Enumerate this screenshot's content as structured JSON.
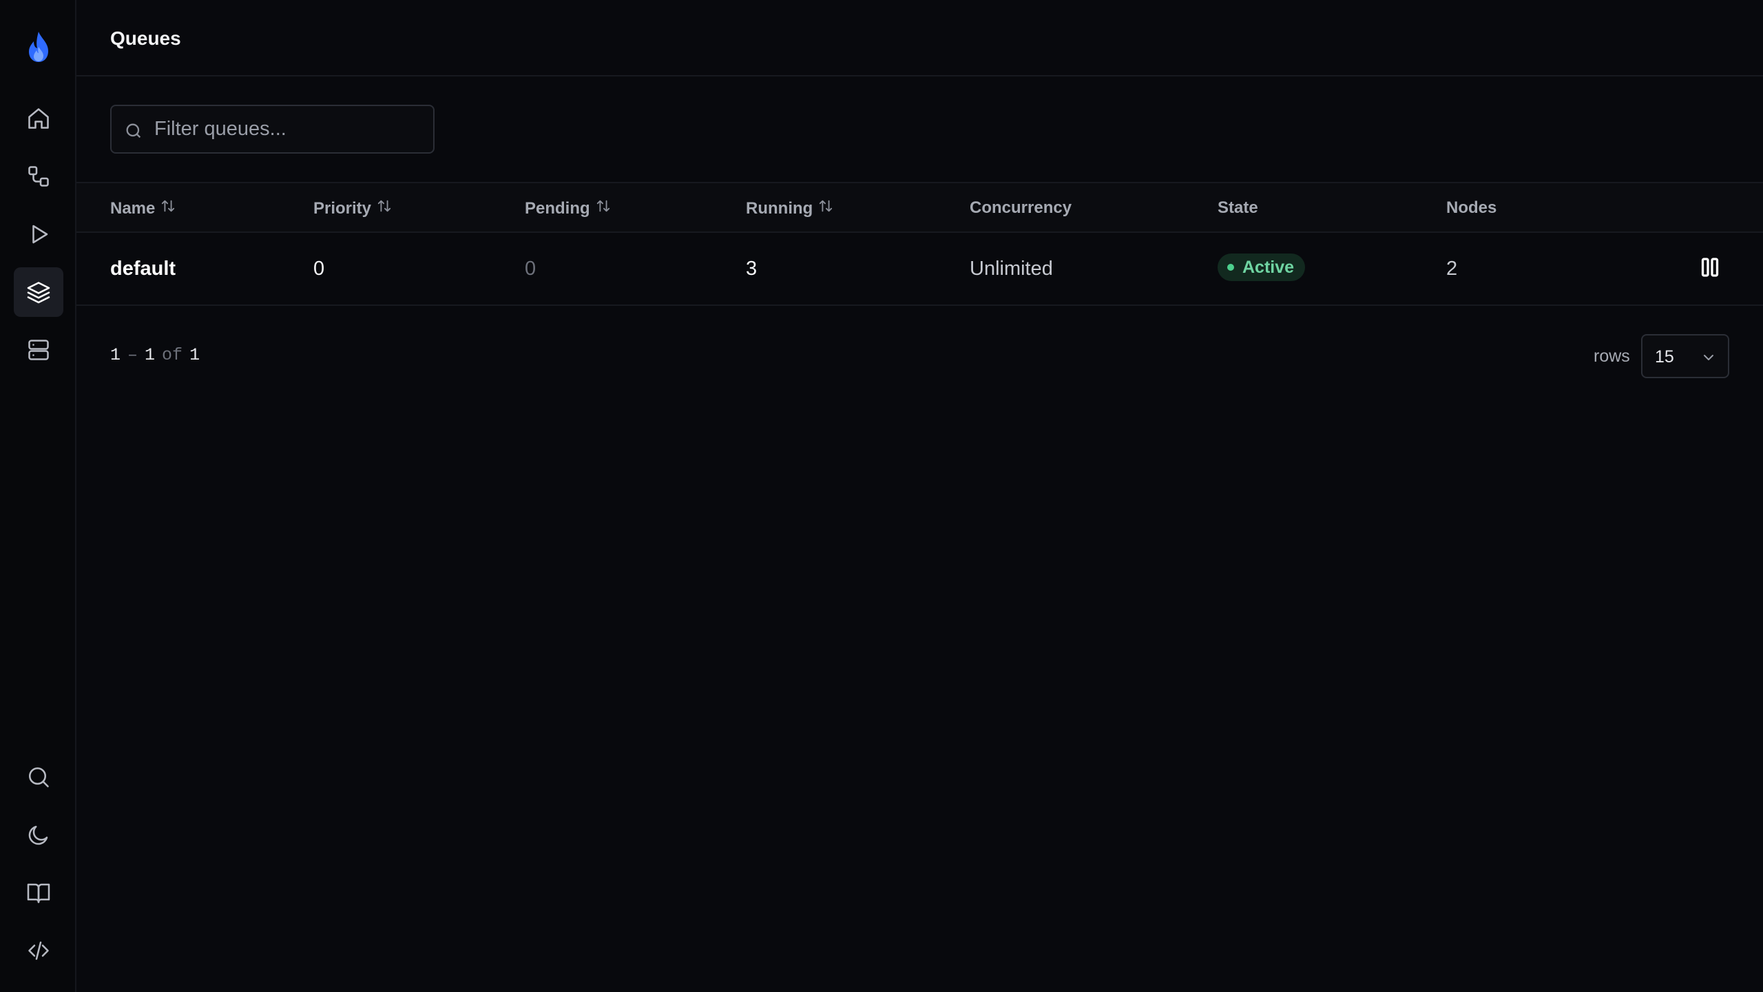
{
  "header": {
    "title": "Queues"
  },
  "search": {
    "placeholder": "Filter queues..."
  },
  "table": {
    "columns": [
      {
        "label": "Name",
        "sortable": true
      },
      {
        "label": "Priority",
        "sortable": true
      },
      {
        "label": "Pending",
        "sortable": true
      },
      {
        "label": "Running",
        "sortable": true
      },
      {
        "label": "Concurrency",
        "sortable": false
      },
      {
        "label": "State",
        "sortable": false
      },
      {
        "label": "Nodes",
        "sortable": false
      }
    ],
    "rows": [
      {
        "name": "default",
        "priority": "0",
        "pending": "0",
        "running": "3",
        "concurrency": "Unlimited",
        "state": "Active",
        "nodes": "2"
      }
    ]
  },
  "pagination": {
    "start": "1",
    "dash": "–",
    "end": "1",
    "of": "of",
    "total": "1",
    "rows_label": "rows",
    "rows_per_page": "15"
  },
  "sidebar": {
    "icons": [
      "flame-logo-icon",
      "home-icon",
      "workflow-icon",
      "play-icon",
      "layers-icon",
      "server-icon",
      "search-icon",
      "moon-icon",
      "book-icon",
      "code-icon"
    ],
    "active": "layers-icon"
  },
  "colors": {
    "accent": "#3b82f6",
    "status_active": "#6fd4a2"
  }
}
